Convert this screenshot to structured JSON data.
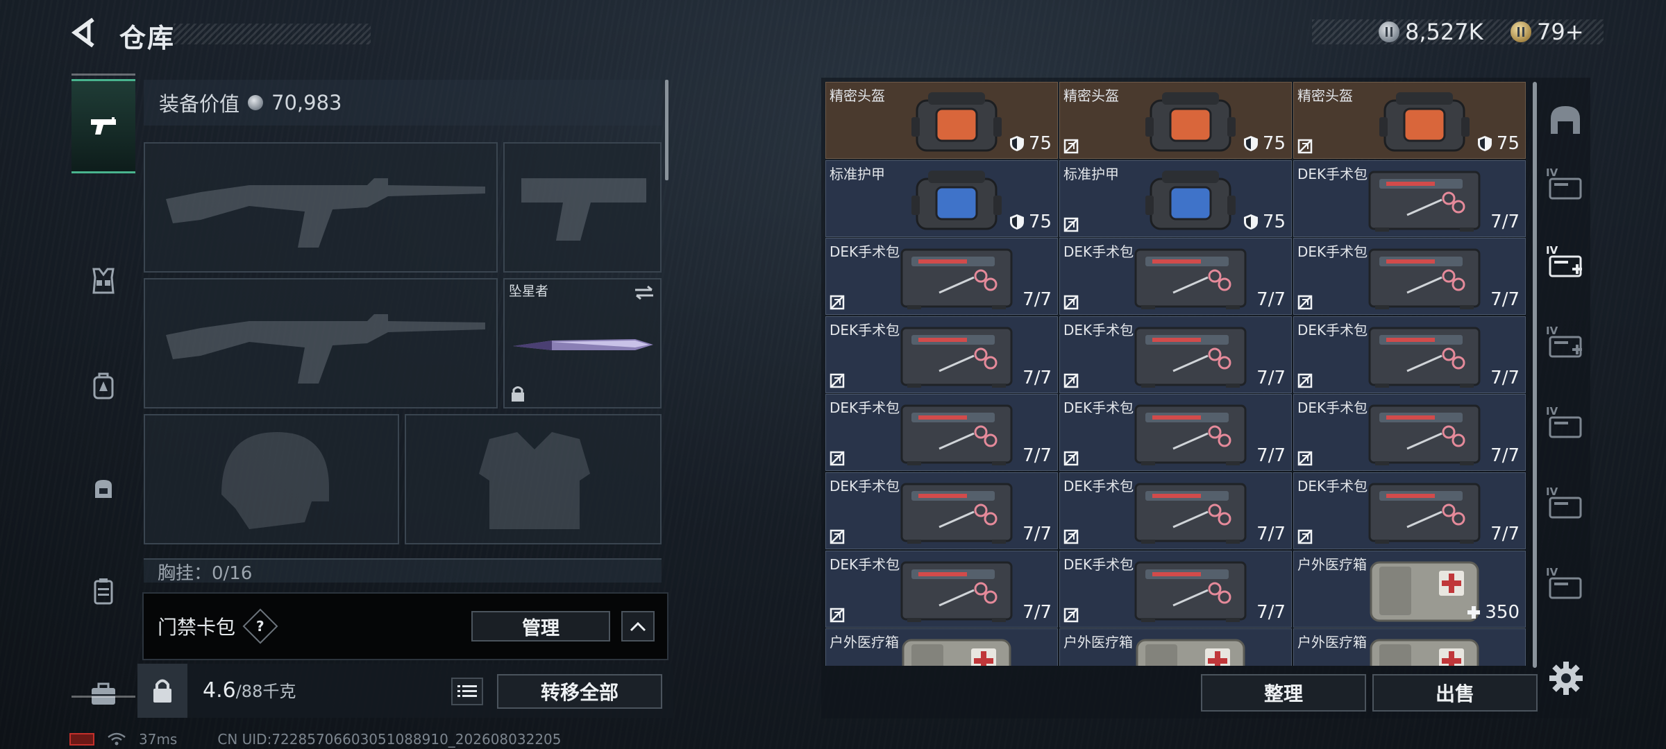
{
  "header": {
    "title": "仓库"
  },
  "currency": {
    "silver": "8,527K",
    "gold": "79+"
  },
  "nav": {
    "items": [
      {
        "name": "weapons",
        "icon": "pistol-icon",
        "active": true
      },
      {
        "name": "vest",
        "icon": "chest-rig-icon",
        "active": false
      },
      {
        "name": "backpack",
        "icon": "backpack-icon",
        "active": false
      },
      {
        "name": "small-backpack",
        "icon": "small-pack-icon",
        "active": false
      },
      {
        "name": "case",
        "icon": "container-icon",
        "active": false
      },
      {
        "name": "toolbox",
        "icon": "toolbox-icon",
        "active": false
      }
    ]
  },
  "equipment": {
    "value_label": "装备价值",
    "value": "70,983",
    "melee_name": "坠星者",
    "chest_label": "胸挂：0/16"
  },
  "card_bag": {
    "label": "门禁卡包",
    "help": "?",
    "manage": "管理"
  },
  "bottom": {
    "weight_current": "4.6",
    "weight_max": "/88千克",
    "transfer_all": "转移全部"
  },
  "status": {
    "ping": "37ms",
    "uid": "CN UID:72285706603051088910_202608032205"
  },
  "inventory": {
    "items": [
      {
        "name": "精密头盔",
        "qty": "75",
        "type": "helmet",
        "shield": true,
        "nodrop": false,
        "bg": "brown"
      },
      {
        "name": "精密头盔",
        "qty": "75",
        "type": "helmet",
        "shield": true,
        "nodrop": true,
        "bg": "brown"
      },
      {
        "name": "精密头盔",
        "qty": "75",
        "type": "helmet",
        "shield": true,
        "nodrop": true,
        "bg": "brown"
      },
      {
        "name": "标准护甲",
        "qty": "75",
        "type": "armor",
        "shield": true,
        "nodrop": false,
        "bg": "blue"
      },
      {
        "name": "标准护甲",
        "qty": "75",
        "type": "armor",
        "shield": true,
        "nodrop": true,
        "bg": "blue"
      },
      {
        "name": "DEK手术包",
        "qty": "7/7",
        "type": "kit",
        "shield": false,
        "nodrop": false,
        "bg": "blue"
      },
      {
        "name": "DEK手术包",
        "qty": "7/7",
        "type": "kit",
        "shield": false,
        "nodrop": true,
        "bg": "blue"
      },
      {
        "name": "DEK手术包",
        "qty": "7/7",
        "type": "kit",
        "shield": false,
        "nodrop": true,
        "bg": "blue"
      },
      {
        "name": "DEK手术包",
        "qty": "7/7",
        "type": "kit",
        "shield": false,
        "nodrop": true,
        "bg": "blue"
      },
      {
        "name": "DEK手术包",
        "qty": "7/7",
        "type": "kit",
        "shield": false,
        "nodrop": true,
        "bg": "blue"
      },
      {
        "name": "DEK手术包",
        "qty": "7/7",
        "type": "kit",
        "shield": false,
        "nodrop": true,
        "bg": "blue"
      },
      {
        "name": "DEK手术包",
        "qty": "7/7",
        "type": "kit",
        "shield": false,
        "nodrop": true,
        "bg": "blue"
      },
      {
        "name": "DEK手术包",
        "qty": "7/7",
        "type": "kit",
        "shield": false,
        "nodrop": true,
        "bg": "blue"
      },
      {
        "name": "DEK手术包",
        "qty": "7/7",
        "type": "kit",
        "shield": false,
        "nodrop": true,
        "bg": "blue"
      },
      {
        "name": "DEK手术包",
        "qty": "7/7",
        "type": "kit",
        "shield": false,
        "nodrop": true,
        "bg": "blue"
      },
      {
        "name": "DEK手术包",
        "qty": "7/7",
        "type": "kit",
        "shield": false,
        "nodrop": true,
        "bg": "blue"
      },
      {
        "name": "DEK手术包",
        "qty": "7/7",
        "type": "kit",
        "shield": false,
        "nodrop": true,
        "bg": "blue"
      },
      {
        "name": "DEK手术包",
        "qty": "7/7",
        "type": "kit",
        "shield": false,
        "nodrop": true,
        "bg": "blue"
      },
      {
        "name": "DEK手术包",
        "qty": "7/7",
        "type": "kit",
        "shield": false,
        "nodrop": true,
        "bg": "blue"
      },
      {
        "name": "DEK手术包",
        "qty": "7/7",
        "type": "kit",
        "shield": false,
        "nodrop": true,
        "bg": "blue"
      },
      {
        "name": "户外医疗箱",
        "qty": "350",
        "type": "medbox",
        "shield": false,
        "nodrop": false,
        "plus": true,
        "bg": "blue"
      },
      {
        "name": "户外医疗箱",
        "qty": "",
        "type": "medbox",
        "shield": false,
        "nodrop": false,
        "bg": "blue"
      },
      {
        "name": "户外医疗箱",
        "qty": "",
        "type": "medbox",
        "shield": false,
        "nodrop": false,
        "bg": "blue"
      },
      {
        "name": "户外医疗箱",
        "qty": "",
        "type": "medbox",
        "shield": false,
        "nodrop": false,
        "bg": "blue"
      }
    ],
    "sort": "整理",
    "sell": "出售"
  },
  "rail": {
    "items": [
      {
        "icon": "helmet-slot-icon",
        "tier": ""
      },
      {
        "icon": "container-tier-icon",
        "tier": "IV"
      },
      {
        "icon": "medkit-tier-icon",
        "tier": "IV"
      },
      {
        "icon": "medkit-tier-icon",
        "tier": "IV"
      },
      {
        "icon": "ammo-box-tier-icon",
        "tier": "IV"
      },
      {
        "icon": "folder-tier-icon",
        "tier": "IV"
      },
      {
        "icon": "tools-tier-icon",
        "tier": "IV"
      }
    ]
  },
  "colors": {
    "accent": "#49b48e",
    "cell_blue": "#29344a",
    "cell_brown": "#4a3a2e"
  }
}
